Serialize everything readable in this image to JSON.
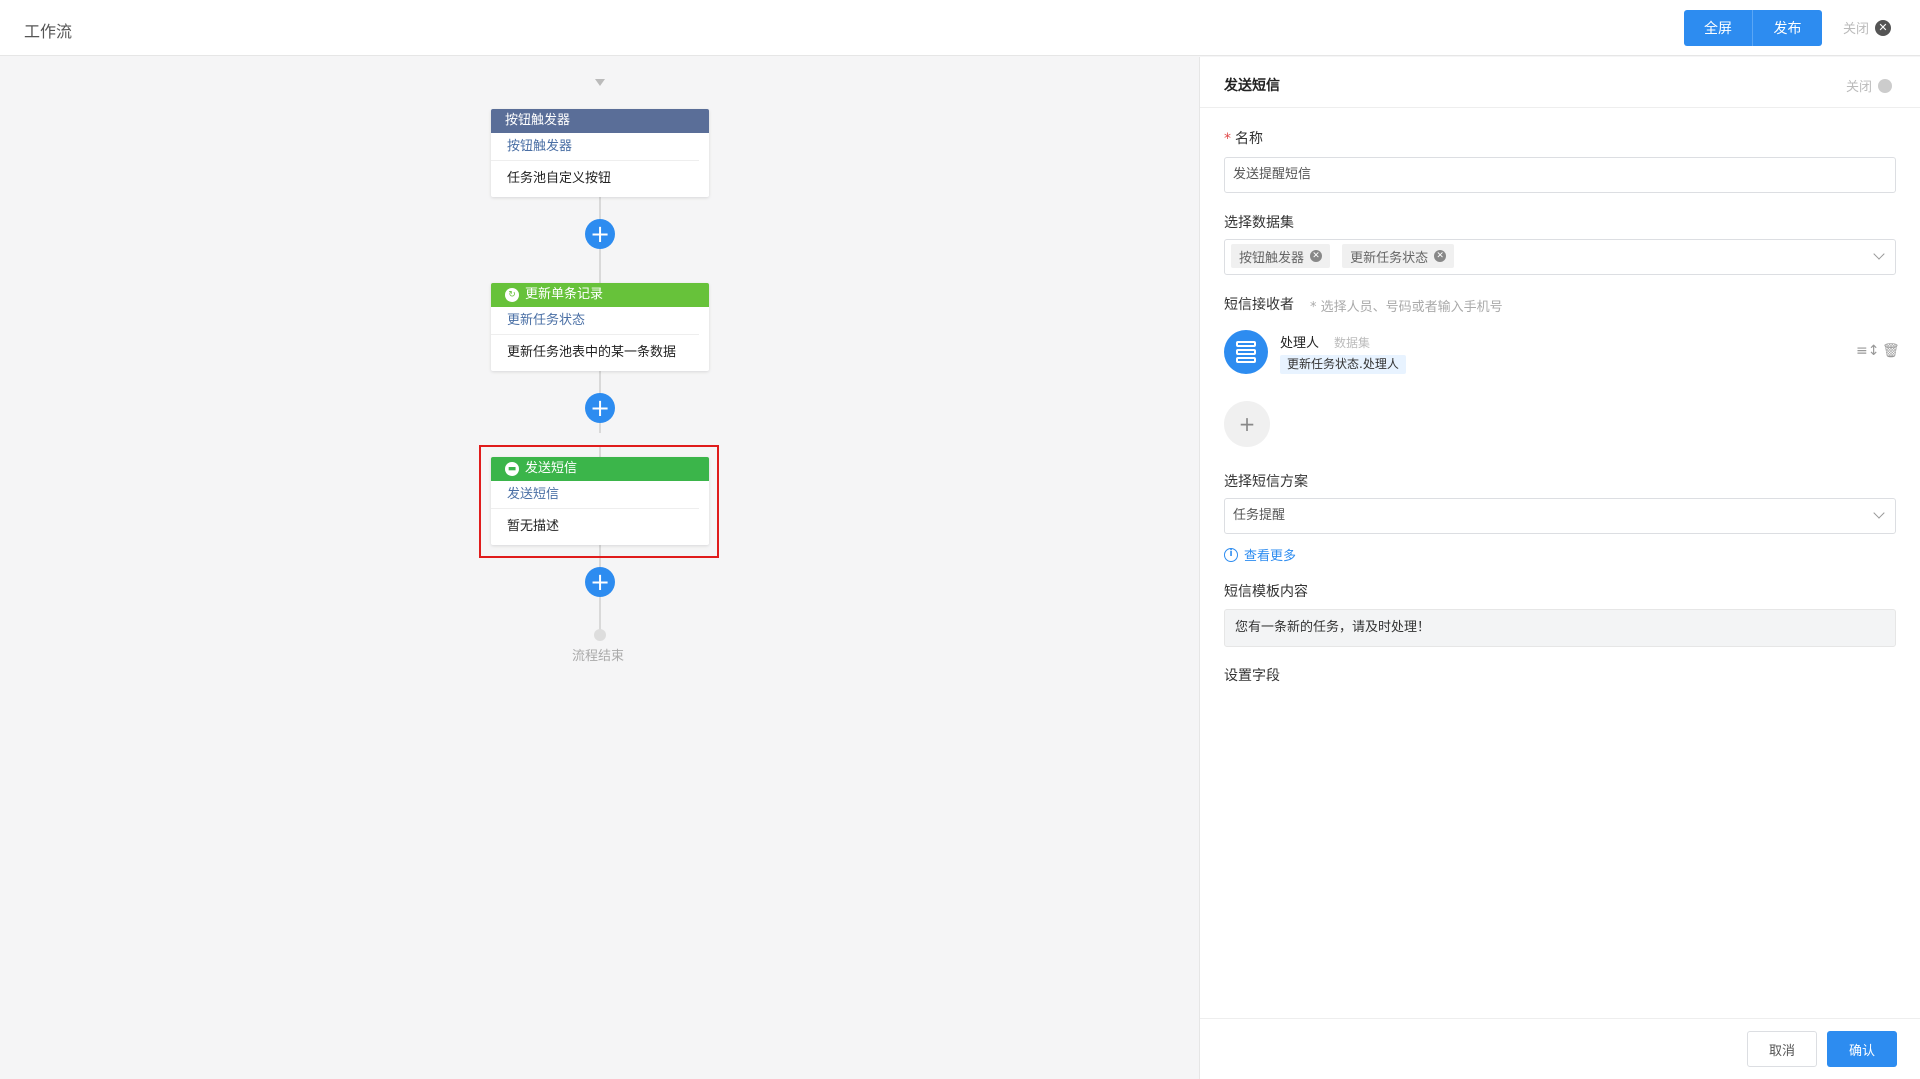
{
  "app": {
    "title": "工作流"
  },
  "toolbar": {
    "fullscreen_label": "全屏",
    "publish_label": "发布",
    "close_label": "关闭"
  },
  "flow": {
    "nodes": [
      {
        "header": "按钮触发器",
        "subtitle": "按钮触发器",
        "description": "任务池自定义按钮",
        "color": "#5a6e98",
        "icon": ""
      },
      {
        "header": "更新单条记录",
        "subtitle": "更新任务状态",
        "description": "更新任务池表中的某一条数据",
        "color": "#67c23a",
        "icon": "refresh-icon"
      },
      {
        "header": "发送短信",
        "subtitle": "发送短信",
        "description": "暂无描述",
        "color": "#3bb54a",
        "icon": "message-icon"
      }
    ],
    "end_label": "流程结束"
  },
  "panel": {
    "title": "发送短信",
    "close_label": "关闭",
    "name_label": "名称",
    "name_value": "发送提醒短信",
    "dataset_label": "选择数据集",
    "dataset_tags": [
      "按钮触发器",
      "更新任务状态"
    ],
    "recipient_label": "短信接收者",
    "recipient_hint": "* 选择人员、号码或者输入手机号",
    "recipient": {
      "name": "处理人",
      "type": "数据集",
      "chip": "更新任务状态.处理人"
    },
    "scheme_label": "选择短信方案",
    "scheme_value": "任务提醒",
    "more_link": "查看更多",
    "template_label": "短信模板内容",
    "template_value": "您有一条新的任务，请及时处理！",
    "fields_label": "设置字段",
    "cancel_label": "取消",
    "confirm_label": "确认"
  },
  "colors": {
    "accent": "#2d8cf0",
    "selection": "#e01c1c"
  }
}
